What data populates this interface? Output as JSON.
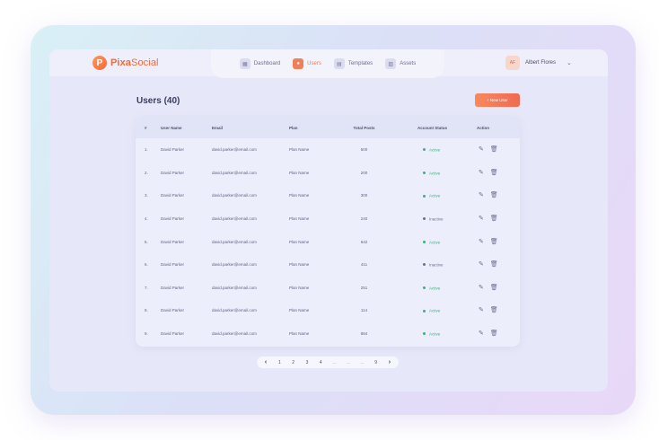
{
  "app": {
    "logo_letter": "P",
    "brand_first": "Pixa",
    "brand_second": "Social"
  },
  "nav": [
    {
      "label": "Dashboard",
      "icon": "grid-icon",
      "glyph": "▦",
      "active": false
    },
    {
      "label": "Users",
      "icon": "users-icon",
      "glyph": "👥",
      "active": true
    },
    {
      "label": "Templates",
      "icon": "templates-icon",
      "glyph": "▤",
      "active": false
    },
    {
      "label": "Assets",
      "icon": "assets-icon",
      "glyph": "▨",
      "active": false
    }
  ],
  "user": {
    "initials": "AF",
    "name": "Albert Flores",
    "chevron": "⌄"
  },
  "page": {
    "title": "Users (40)",
    "new_user_label": "+ New User"
  },
  "table": {
    "headers": [
      "#",
      "User Name",
      "Email",
      "Plan",
      "Total Posts",
      "Account Status",
      "Action"
    ],
    "rows": [
      {
        "num": "1.",
        "name": "David Parker",
        "email": "david.parker@email.com",
        "plan": "Plan Name",
        "posts": "500",
        "status": "Active"
      },
      {
        "num": "2.",
        "name": "David Parker",
        "email": "david.parker@email.com",
        "plan": "Plan Name",
        "posts": "200",
        "status": "Active"
      },
      {
        "num": "3.",
        "name": "David Parker",
        "email": "david.parker@email.com",
        "plan": "Plan Name",
        "posts": "300",
        "status": "Active"
      },
      {
        "num": "4.",
        "name": "David Parker",
        "email": "david.parker@email.com",
        "plan": "Plan Name",
        "posts": "240",
        "status": "Inactive"
      },
      {
        "num": "5.",
        "name": "David Parker",
        "email": "david.parker@email.com",
        "plan": "Plan Name",
        "posts": "642",
        "status": "Active"
      },
      {
        "num": "6.",
        "name": "David Parker",
        "email": "david.parker@email.com",
        "plan": "Plan Name",
        "posts": "411",
        "status": "Inactive"
      },
      {
        "num": "7.",
        "name": "David Parker",
        "email": "david.parker@email.com",
        "plan": "Plan Name",
        "posts": "251",
        "status": "Active"
      },
      {
        "num": "8.",
        "name": "David Parker",
        "email": "david.parker@email.com",
        "plan": "Plan Name",
        "posts": "114",
        "status": "Active"
      },
      {
        "num": "9.",
        "name": "David Parker",
        "email": "david.parker@email.com",
        "plan": "Plan Name",
        "posts": "884",
        "status": "Active"
      }
    ],
    "action_icons": {
      "edit": "✎",
      "delete": "🗑"
    }
  },
  "pagination": {
    "prev": "‹",
    "pages": [
      "1",
      "2",
      "3",
      "4",
      "...",
      "...",
      "...",
      "9"
    ],
    "next": "›"
  },
  "colors": {
    "accent": "#f07a52",
    "active": "#2fb87a",
    "inactive": "#6b6f8e"
  }
}
